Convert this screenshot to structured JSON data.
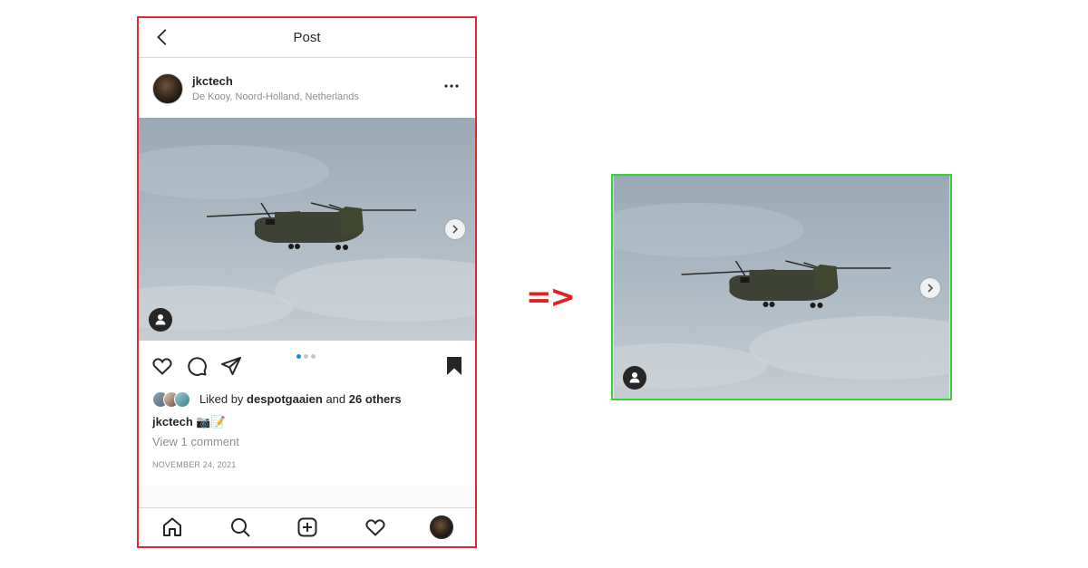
{
  "topbar": {
    "title": "Post",
    "back_icon": "chevron-left-icon"
  },
  "post": {
    "username": "jkctech",
    "location": "De Kooy, Noord-Holland, Netherlands",
    "more_icon": "more-horizontal-icon",
    "carousel": {
      "index": 1,
      "count": 3
    },
    "likes": {
      "prefix": "Liked by ",
      "user": "despotgaaien",
      "middle": " and ",
      "others": "26 others"
    },
    "caption": {
      "username": "jkctech",
      "text": " 📷📝"
    },
    "view_comments": "View 1 comment",
    "date": "NOVEMBER 24, 2021"
  },
  "arrow_text": "=>",
  "colors": {
    "accent": "#0095f6",
    "highlight_red": "#dd2b2b",
    "highlight_green": "#37d437"
  }
}
